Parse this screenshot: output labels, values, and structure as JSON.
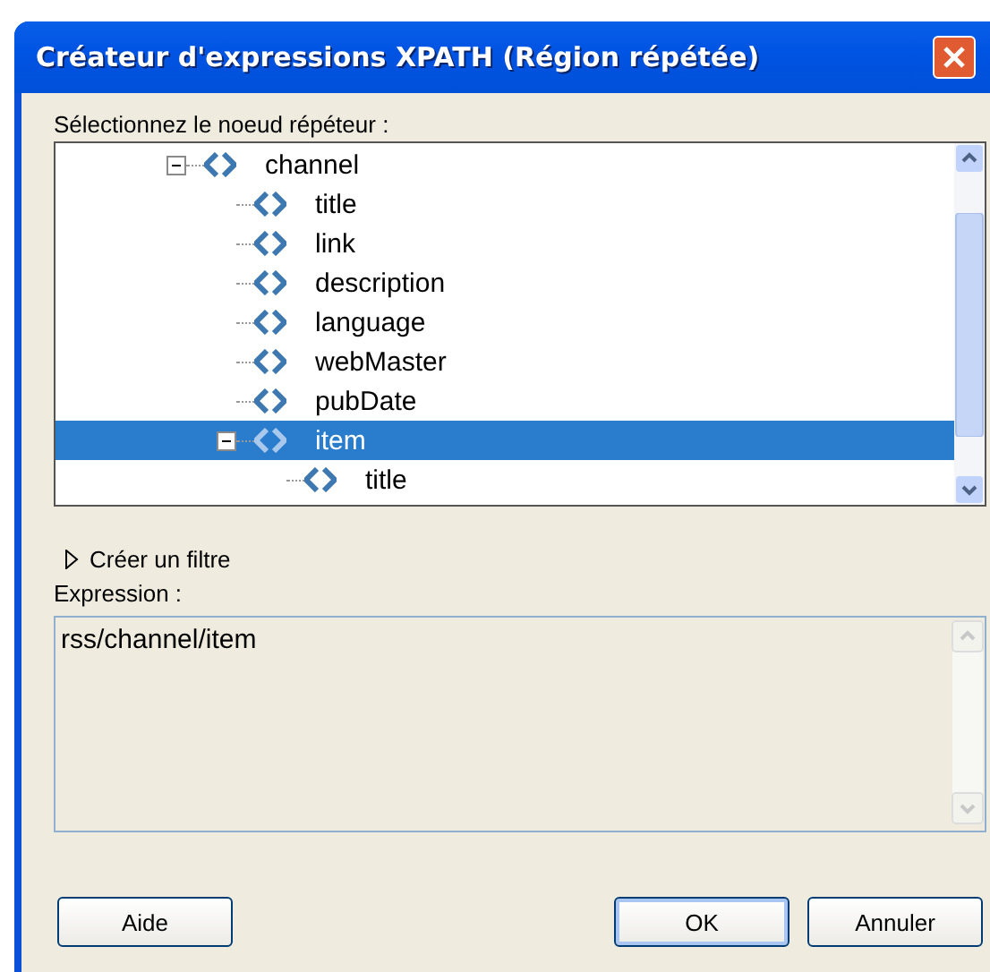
{
  "window": {
    "title": "Créateur d'expressions XPATH (Région répétée)"
  },
  "tree": {
    "label": "Sélectionnez le noeud répéteur :",
    "nodes": [
      {
        "label": "channel",
        "expanded": true,
        "selected": false,
        "children": [
          {
            "label": "title",
            "selected": false
          },
          {
            "label": "link",
            "selected": false
          },
          {
            "label": "description",
            "selected": false
          },
          {
            "label": "language",
            "selected": false
          },
          {
            "label": "webMaster",
            "selected": false
          },
          {
            "label": "pubDate",
            "selected": false
          },
          {
            "label": "item",
            "expanded": true,
            "selected": true,
            "children": [
              {
                "label": "title",
                "selected": false
              }
            ]
          }
        ]
      }
    ]
  },
  "filter": {
    "label": "Créer un filtre",
    "expanded": false
  },
  "expression": {
    "label": "Expression :",
    "value": "rss/channel/item"
  },
  "buttons": [
    {
      "label": "Aide",
      "default": false
    },
    {
      "label": "OK",
      "default": true
    },
    {
      "label": "Annuler",
      "default": false
    }
  ]
}
